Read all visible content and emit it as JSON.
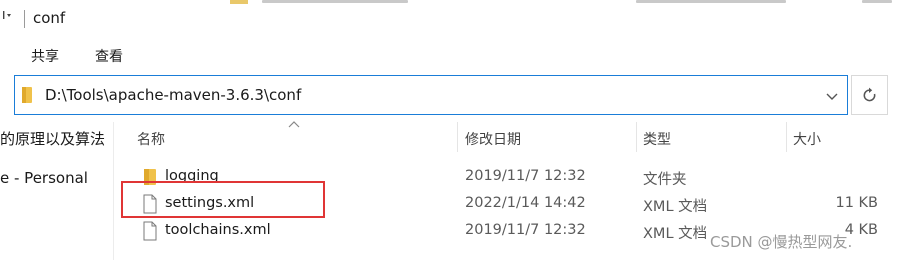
{
  "window": {
    "title": "conf"
  },
  "ribbon": {
    "tabs": [
      {
        "label": "共享"
      },
      {
        "label": "查看"
      }
    ]
  },
  "address": {
    "path": "D:\\Tools\\apache-maven-3.6.3\\conf"
  },
  "navigation": {
    "items": [
      {
        "label": "的原理以及算法"
      },
      {
        "label": "e - Personal"
      }
    ]
  },
  "columns": {
    "name": "名称",
    "modified": "修改日期",
    "type": "类型",
    "size": "大小"
  },
  "files": [
    {
      "name": "logging",
      "modified": "2019/11/7 12:32",
      "type": "文件夹",
      "size": "",
      "kind": "folder"
    },
    {
      "name": "settings.xml",
      "modified": "2022/1/14 14:42",
      "type": "XML 文档",
      "size": "11 KB",
      "kind": "file"
    },
    {
      "name": "toolchains.xml",
      "modified": "2019/11/7 12:32",
      "type": "XML 文档",
      "size": "4 KB",
      "kind": "file"
    }
  ],
  "highlight": {
    "color": "#e03535"
  },
  "colors": {
    "accent": "#1a7dd8",
    "folder": "#f0c24b"
  },
  "watermark": {
    "text": "CSDN @慢热型网友."
  }
}
